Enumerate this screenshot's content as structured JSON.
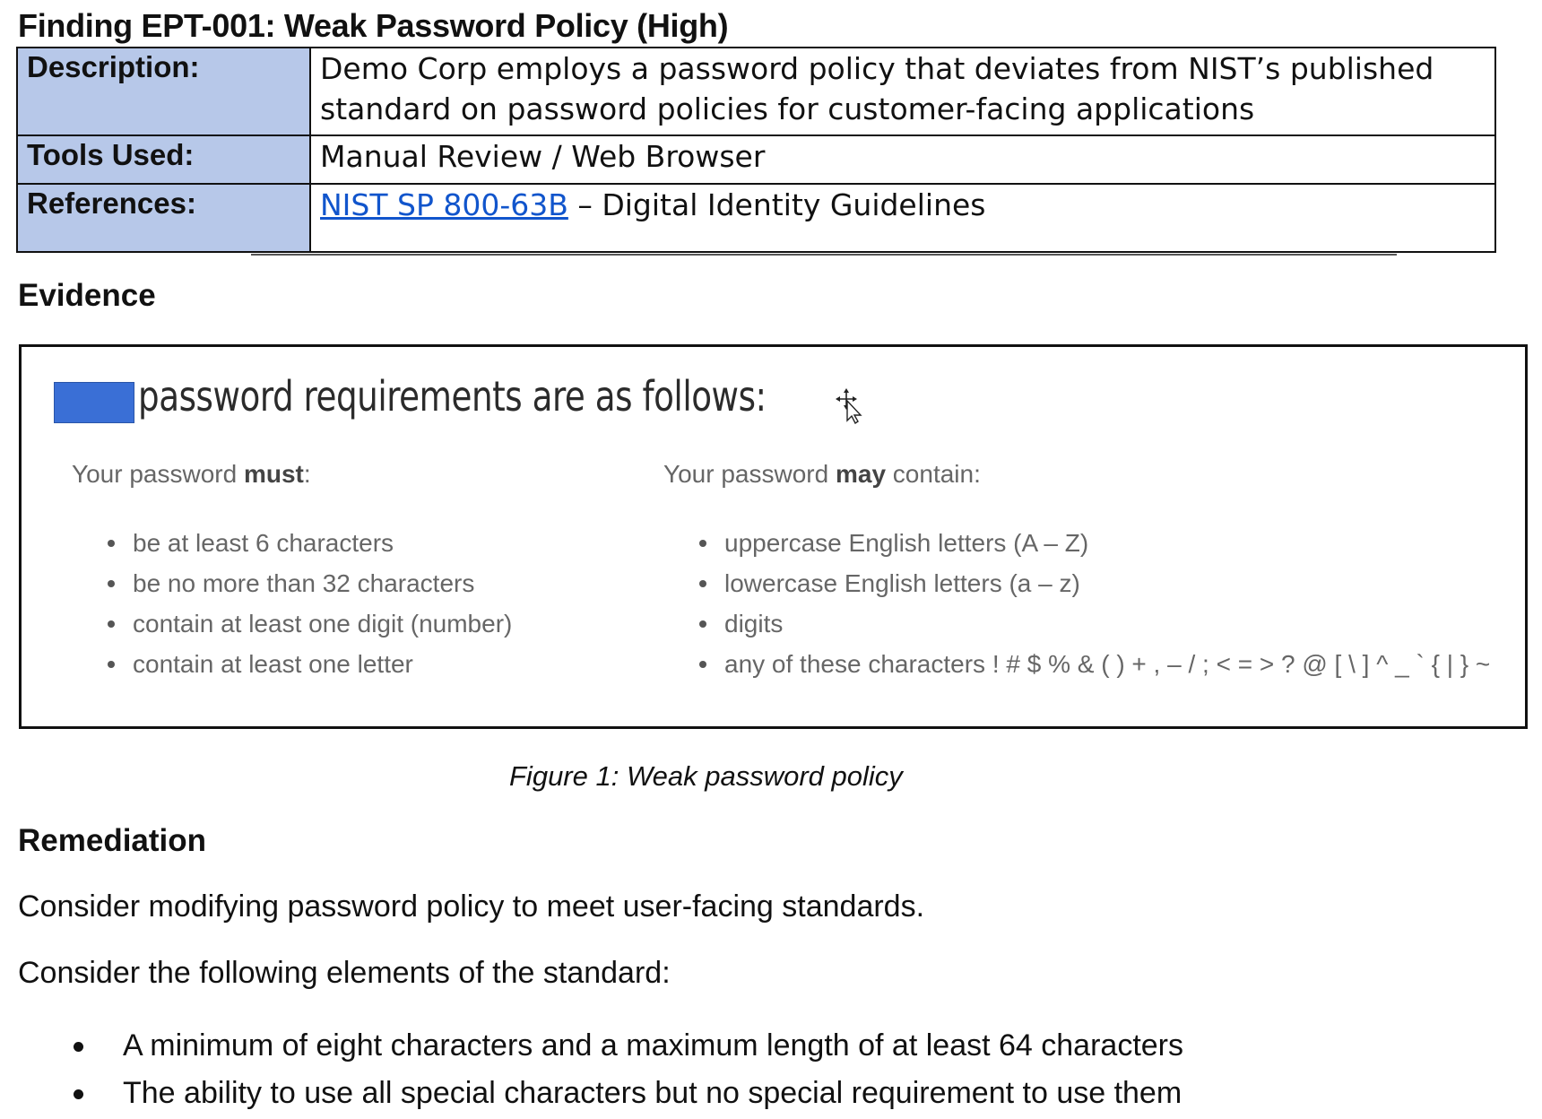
{
  "finding": {
    "title": "Finding EPT-001: Weak Password Policy (High)",
    "rows": {
      "description": {
        "label": "Description:",
        "value": "Demo Corp employs a password policy that deviates from NIST’s published standard on password policies for customer-facing applications"
      },
      "tools": {
        "label": "Tools Used:",
        "value": "Manual Review / Web Browser"
      },
      "references": {
        "label": "References:",
        "link_text": "NIST SP 800-63B",
        "suffix": " – Digital Identity Guidelines"
      }
    }
  },
  "evidence": {
    "heading": "Evidence",
    "screenshot": {
      "heading": "password requirements are as follows:",
      "redaction_color": "#3a6fd6",
      "left": {
        "intro_before": "Your password ",
        "intro_bold": "must",
        "intro_after": ":",
        "items": [
          "be at least 6 characters",
          "be no more than 32 characters",
          "contain at least one digit (number)",
          "contain at least one letter"
        ]
      },
      "right": {
        "intro_before": "Your password ",
        "intro_bold": "may",
        "intro_after": " contain:",
        "items": [
          "uppercase English letters (A – Z)",
          "lowercase English letters (a – z)",
          "digits",
          "any of these characters ! # $ % & ( ) + , – / ; < = > ? @ [ \\ ] ^ _ ` { | } ~"
        ]
      }
    },
    "caption": "Figure 1: Weak password policy"
  },
  "remediation": {
    "heading": "Remediation",
    "paragraph1": "Consider modifying password policy to meet user-facing standards.",
    "paragraph2": "Consider the following elements of the standard:",
    "items": [
      "A minimum of eight characters and a maximum length of at least 64 characters",
      "The ability to use all special characters but no special requirement to use them"
    ]
  },
  "colors": {
    "label_background": "#b7c8e9",
    "link": "#1155cc",
    "screenshot_text": "#666666"
  },
  "icons": {
    "cursor": "move-cursor-icon"
  }
}
